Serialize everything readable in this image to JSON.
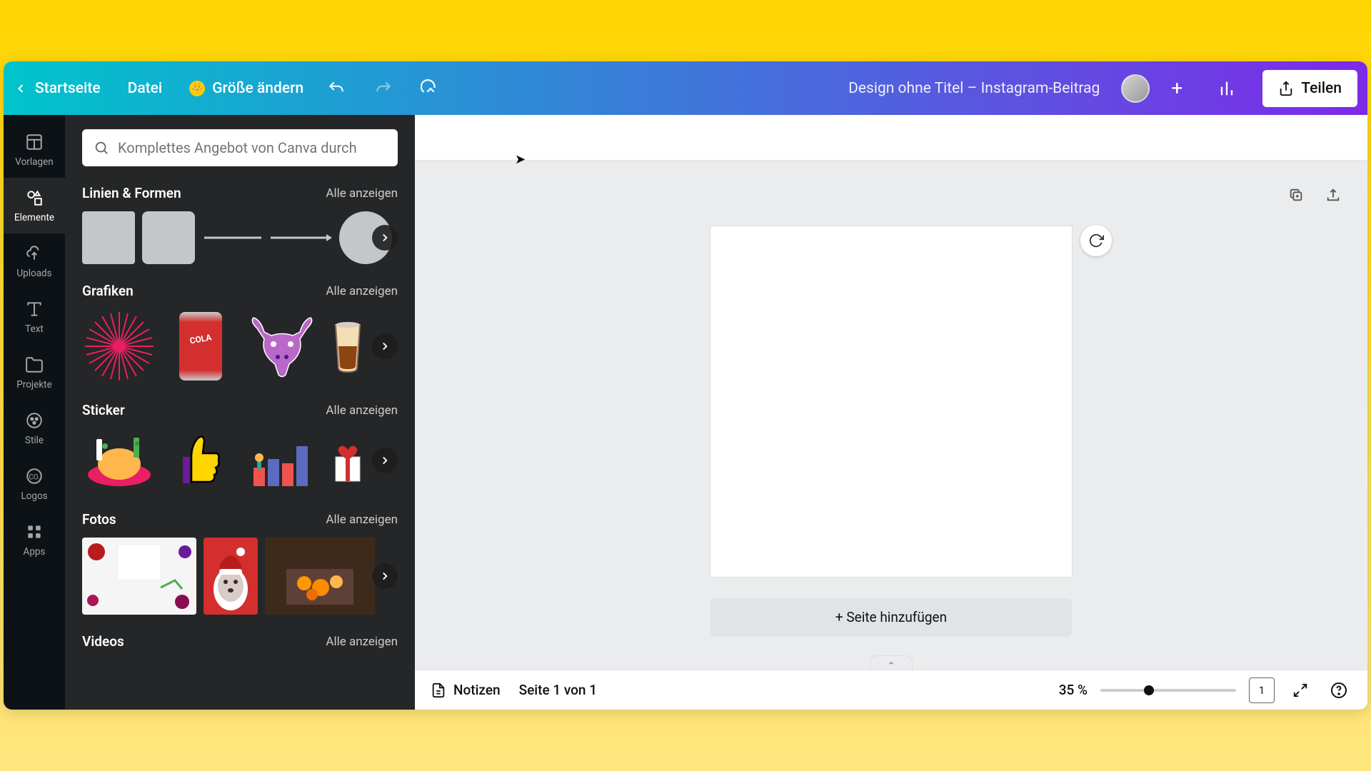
{
  "topbar": {
    "home_label": "Startseite",
    "file_label": "Datei",
    "resize_label": "Größe ändern",
    "title": "Design ohne Titel – Instagram-Beitrag",
    "share_label": "Teilen",
    "add_symbol": "+"
  },
  "rail": {
    "templates": "Vorlagen",
    "elements": "Elemente",
    "uploads": "Uploads",
    "text": "Text",
    "projects": "Projekte",
    "styles": "Stile",
    "logos": "Logos",
    "apps": "Apps"
  },
  "search": {
    "placeholder": "Komplettes Angebot von Canva durch"
  },
  "sections": {
    "lines_shapes": {
      "title": "Linien & Formen",
      "see_all": "Alle anzeigen"
    },
    "graphics": {
      "title": "Grafiken",
      "see_all": "Alle anzeigen"
    },
    "stickers": {
      "title": "Sticker",
      "see_all": "Alle anzeigen"
    },
    "photos": {
      "title": "Fotos",
      "see_all": "Alle anzeigen"
    },
    "videos": {
      "title": "Videos",
      "see_all": "Alle anzeigen"
    }
  },
  "canvas": {
    "add_page_label": "+ Seite hinzufügen"
  },
  "bottombar": {
    "notes_label": "Notizen",
    "page_indicator": "Seite 1 von 1",
    "zoom_label": "35 %",
    "zoom_value": 35,
    "page_count": "1"
  },
  "colors": {
    "accent_start": "#00c4cc",
    "accent_end": "#7d2ae8",
    "dark_panel": "#252627",
    "rail": "#0d1216"
  }
}
